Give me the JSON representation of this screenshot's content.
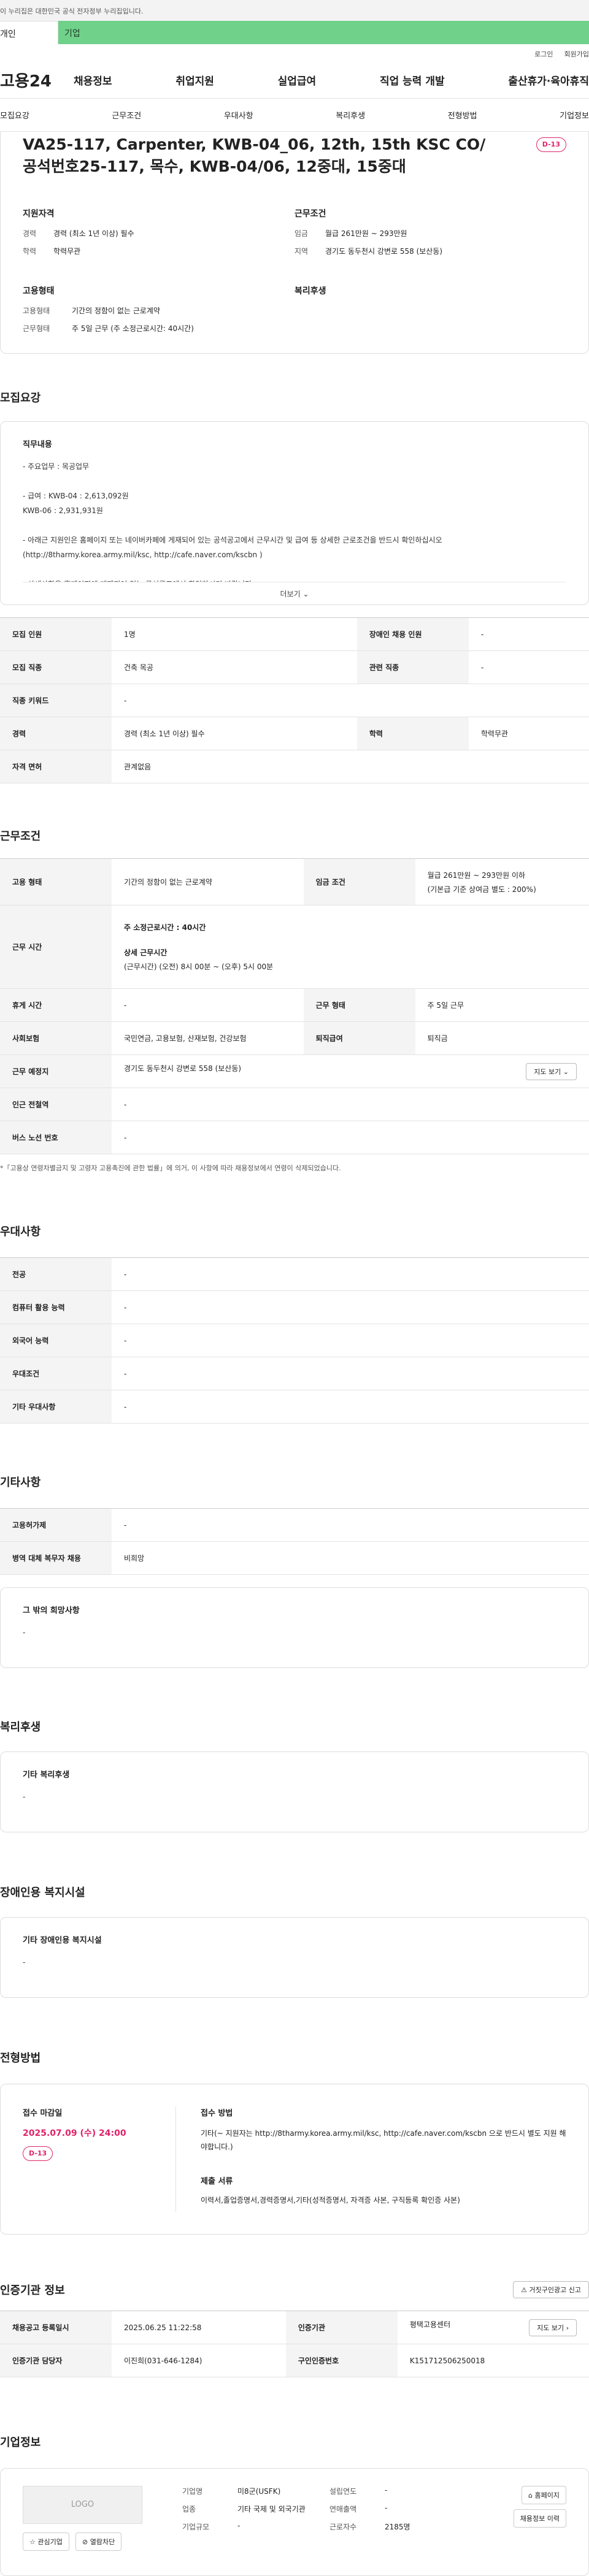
{
  "gov_bar": "이 누리집은 대한민국 공식 전자정부 누리집입니다.",
  "tabs": [
    "개인",
    "기업"
  ],
  "util": [
    "로그인",
    "회원가입"
  ],
  "logo": "고용24",
  "gnb": [
    "채용정보",
    "취업지원",
    "실업급여",
    "직업 능력 개발",
    "출산휴가·육아휴직"
  ],
  "subnav": [
    "모집요강",
    "근무조건",
    "우대사항",
    "복리후생",
    "전형방법",
    "기업정보"
  ],
  "hero": {
    "title": "VA25-117, Carpenter, KWB-04_06, 12th, 15th KSC CO/공석번호25-117, 목수, KWB-04/06, 12중대, 15중대",
    "dday": "D-13",
    "qual_title": "지원자격",
    "qual": [
      {
        "k": "경력",
        "v": "경력 (최소 1년 이상) 필수"
      },
      {
        "k": "학력",
        "v": "학력무관"
      }
    ],
    "cond_title": "근무조건",
    "cond": [
      {
        "k": "임금",
        "v": "월급 261만원 ~ 293만원"
      },
      {
        "k": "지역",
        "v": "경기도 동두천시 강변로 558 (보산동)"
      }
    ],
    "emp_title": "고용형태",
    "emp": [
      {
        "k": "고용형태",
        "v": "기간의 정함이 없는 근로계약"
      },
      {
        "k": "근무형태",
        "v": "주 5일 근무 (주 소정근로시간: 40시간)"
      }
    ],
    "welfare_title": "복리후생"
  },
  "recruit": {
    "title": "모집요강",
    "duty_title": "직무내용",
    "duty_text": "- 주요업무 : 목공업무\n\n- 급여 : KWB-04 : 2,613,092원\n           KWB-06 : 2,931,931원\n\n- 아래근 지원인은 홈페이지 또는 네이버카페에 게재되어 있는 공석공고에서 근무시간 및 급여 등 상세한 근로조건을 반드시 확인하십시오 (http://8tharmy.korea.army.mil/ksc, http://cafe.naver.com/kscbn )\n\n- 상세사항은 홈페이지에 게재되어 있는 공석공고에서 확인하시기 바랍니다",
    "more": "더보기",
    "rows": [
      [
        "모집 인원",
        "1명",
        "장애인 채용 인원",
        "-"
      ],
      [
        "모집 직종",
        "건축 목공",
        "관련 직종",
        "-"
      ],
      [
        "직종 키워드",
        "-",
        "",
        ""
      ],
      [
        "경력",
        "경력 (최소 1년 이상) 필수",
        "학력",
        "학력무관"
      ],
      [
        "자격 면허",
        "관계없음",
        "",
        ""
      ]
    ]
  },
  "work": {
    "title": "근무조건",
    "emp_type_h": "고용 형태",
    "emp_type": "기간의 정함이 없는 근로계약",
    "wage_h": "임금 조건",
    "wage": "월급 261만원 ~ 293만원 이하",
    "wage_sub": "(기본급 기준 상여금 별도 : 200%)",
    "hours_h": "근무 시간",
    "hours_main": "주 소정근로시간 : 40시간",
    "hours_detail_t": "상세 근무시간",
    "hours_detail": "(근무시간) (오전) 8시 00분 ~ (오후) 5시 00분",
    "rows": [
      [
        "휴게 시간",
        "-",
        "근무 형태",
        "주 5일 근무"
      ],
      [
        "사회보험",
        "국민연금, 고용보험, 산재보험, 건강보험",
        "퇴직급여",
        "퇴직금"
      ]
    ],
    "place_h": "근무 예정지",
    "place": "경기도 동두천시 강변로 558 (보산동)",
    "map_btn": "지도 보기",
    "station_h": "인근 전철역",
    "station": "-",
    "bus_h": "버스 노선 번호",
    "bus": "-",
    "note": "*「고용상 연령차별금지 및 고령자 고용촉진에 관한 법률」에 의거, 이 사항에 따라 채용정보에서 연령이 삭제되었습니다."
  },
  "pref": {
    "title": "우대사항",
    "rows": [
      [
        "전공",
        "-"
      ],
      [
        "컴퓨터 활용 능력",
        "-"
      ],
      [
        "외국어 능력",
        "-"
      ],
      [
        "우대조건",
        "-"
      ],
      [
        "기타 우대사항",
        "-"
      ]
    ]
  },
  "etc": {
    "title": "기타사항",
    "rows": [
      [
        "고용허가제",
        "-"
      ],
      [
        "병역 대체 복무자 채용",
        "비희망"
      ]
    ],
    "other_t": "그 밖의 희망사항",
    "other": "-"
  },
  "welfare": {
    "title": "복리후생",
    "sub": "기타 복리후생",
    "val": "-"
  },
  "disabled": {
    "title": "장애인용 복지시설",
    "sub": "기타 장애인용 복지시설",
    "val": "-"
  },
  "apply": {
    "title": "전형방법",
    "deadline_t": "접수 마감일",
    "deadline": "2025.07.09 (수) 24:00",
    "dday": "D-13",
    "method_t": "접수 방법",
    "method": "기타(~ 지원자는 http://8tharmy.korea.army.mil/ksc, http://cafe.naver.com/kscbn 으로 반드시 별도 지원 해야합니다.)",
    "docs_t": "제출 서류",
    "docs": "이력서,졸업증명서,경력증명서,기타(성적증명서, 자격증 사본, 구직등록 확인증 사본)"
  },
  "agency": {
    "title": "인증기관 정보",
    "report_btn": "거짓구인광고 신고",
    "rows": [
      [
        "채용공고 등록일시",
        "2025.06.25 11:22:58",
        "인증기관",
        "평택고용센터"
      ],
      [
        "인증기관 담당자",
        "이진희(031-646-1284)",
        "구인인증번호",
        "K151712506250018"
      ]
    ],
    "map_btn": "지도 보기"
  },
  "corp": {
    "title": "기업정보",
    "logo": "LOGO",
    "fav_btn": "관심기업",
    "block_btn": "열람차단",
    "fields": [
      [
        "기업명",
        "미8군(USFK)"
      ],
      [
        "업종",
        "기타 국제 및 외국기관"
      ],
      [
        "기업규모",
        "-"
      ]
    ],
    "fields2": [
      [
        "설립연도",
        "-"
      ],
      [
        "연매출액",
        "-"
      ],
      [
        "근로자수",
        "2185명"
      ]
    ],
    "home_btn": "홈페이지",
    "jobs_btn": "채용정보 이력"
  }
}
